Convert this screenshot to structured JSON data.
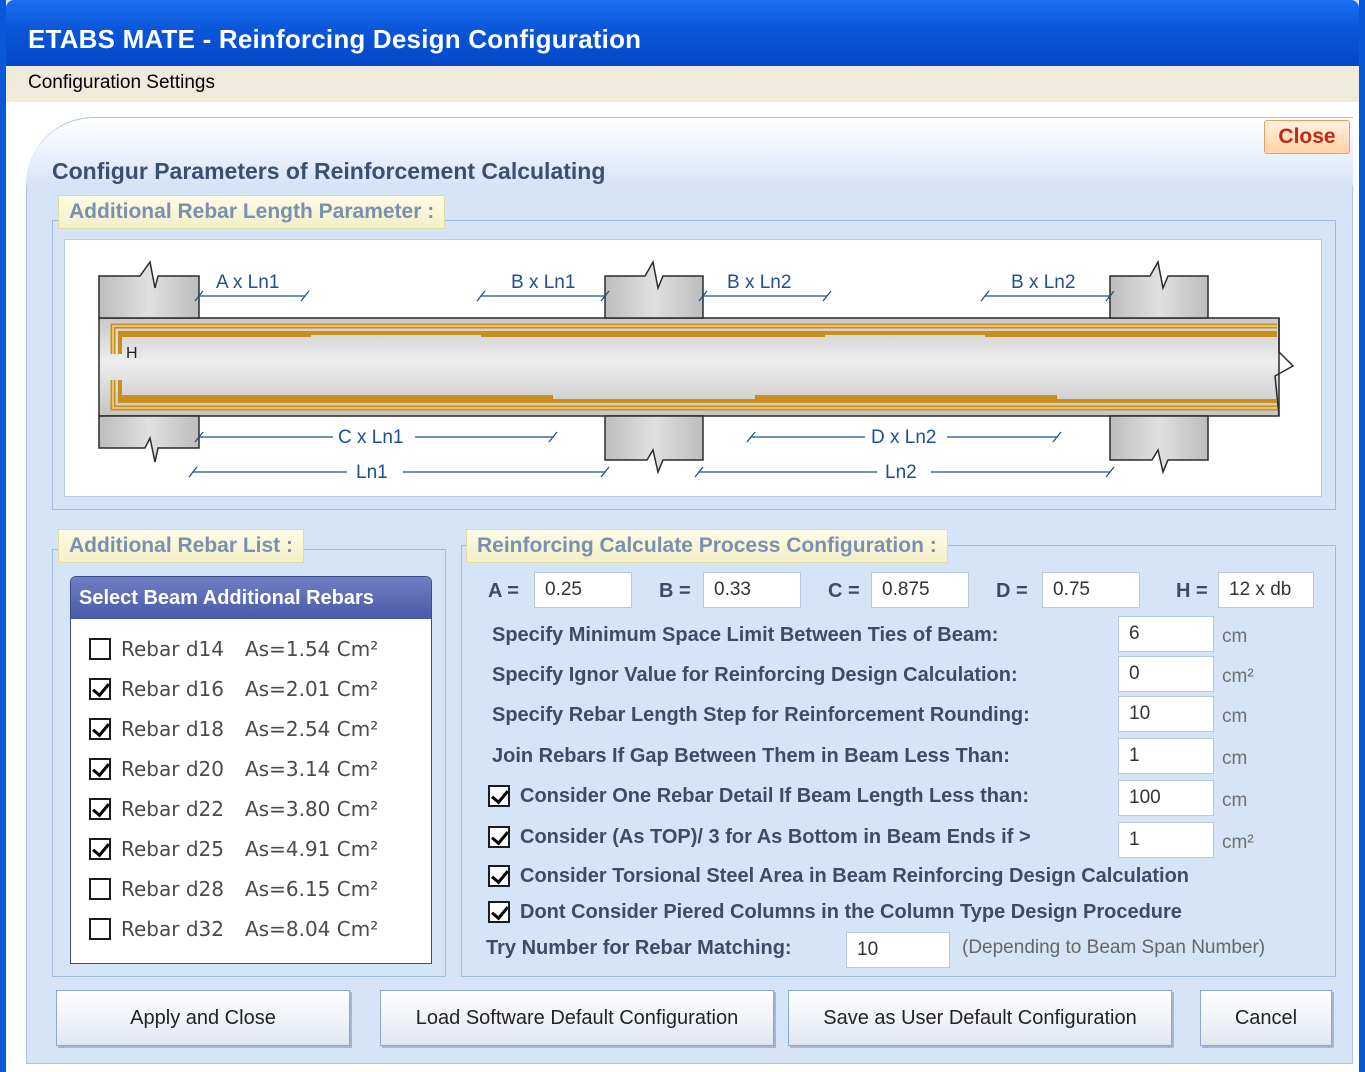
{
  "window": {
    "title": "ETABS MATE - Reinforcing Design Configuration",
    "menu": "Configuration Settings"
  },
  "header": {
    "caption": "Configur Parameters of Reinforcement Calculating",
    "close_label": "Close"
  },
  "rebar_length": {
    "label": "Additional Rebar Length Parameter :",
    "diagram": {
      "top_labels": [
        "A x Ln1",
        "B x Ln1",
        "B x Ln2",
        "B x Ln2"
      ],
      "bottom_labels": [
        "C x Ln1",
        "Ln1",
        "D x Ln2",
        "Ln2"
      ],
      "h_label": "H"
    }
  },
  "rebar_list": {
    "label": "Additional Rebar List :",
    "header": "Select Beam Additional Rebars",
    "items": [
      {
        "name": "Rebar d14",
        "area": "As=1.54  Cm²",
        "checked": false
      },
      {
        "name": "Rebar d16",
        "area": "As=2.01  Cm²",
        "checked": true
      },
      {
        "name": "Rebar d18",
        "area": "As=2.54  Cm²",
        "checked": true
      },
      {
        "name": "Rebar d20",
        "area": "As=3.14  Cm²",
        "checked": true
      },
      {
        "name": "Rebar d22",
        "area": "As=3.80  Cm²",
        "checked": true
      },
      {
        "name": "Rebar d25",
        "area": "As=4.91  Cm²",
        "checked": true
      },
      {
        "name": "Rebar d28",
        "area": "As=6.15  Cm²",
        "checked": false
      },
      {
        "name": "Rebar d32",
        "area": "As=8.04  Cm²",
        "checked": false
      }
    ]
  },
  "process": {
    "label": "Reinforcing Calculate Process Configuration :",
    "params": {
      "a_label": "A =",
      "a_value": "0.25",
      "b_label": "B =",
      "b_value": "0.33",
      "c_label": "C =",
      "c_value": "0.875",
      "d_label": "D =",
      "d_value": "0.75",
      "h_label": "H =",
      "h_value": "12  x db"
    },
    "rows": [
      {
        "label": "Specify Minimum Space Limit  Between  Ties  of  Beam:",
        "value": "6",
        "unit": "cm"
      },
      {
        "label": "Specify Ignor Value for Reinforcing  Design  Calculation:",
        "value": "0",
        "unit": "cm²"
      },
      {
        "label": "Specify Rebar Length Step for Reinforcement Rounding:",
        "value": "10",
        "unit": "cm"
      },
      {
        "label": "Join  Rebars  If Gap Between Them in Beam Less Than:",
        "value": "1",
        "unit": "cm"
      }
    ],
    "checks": [
      {
        "label": "Consider One Rebar Detail If Beam Length Less than:",
        "checked": true,
        "value": "100",
        "unit": "cm"
      },
      {
        "label": "Consider (As TOP)/ 3 for As Bottom in Beam Ends if >",
        "checked": true,
        "value": "1",
        "unit": "cm²"
      },
      {
        "label": "Consider Torsional Steel Area in Beam Reinforcing Design Calculation",
        "checked": true
      },
      {
        "label": "Dont Consider Piered Columns in the Column Type Design Procedure",
        "checked": true
      }
    ],
    "try_label": "Try Number for Rebar Matching:",
    "try_value": "10",
    "try_note": "(Depending to Beam Span Number)"
  },
  "buttons": {
    "apply": "Apply and Close",
    "load_default": "Load Software Default Configuration",
    "save_default": "Save as User Default Configuration",
    "cancel": "Cancel"
  }
}
